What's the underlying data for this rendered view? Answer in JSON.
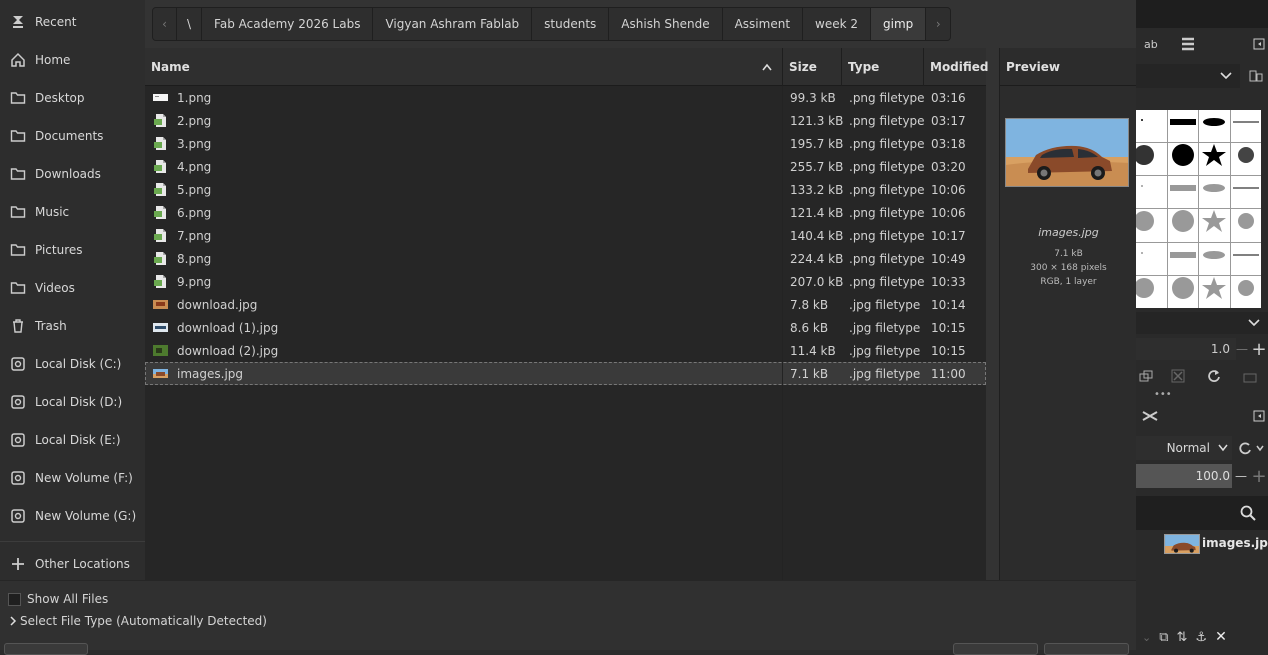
{
  "sidebar": {
    "items": [
      {
        "label": "Recent",
        "icon": "recent-icon"
      },
      {
        "label": "Home",
        "icon": "home-icon"
      },
      {
        "label": "Desktop",
        "icon": "folder-icon"
      },
      {
        "label": "Documents",
        "icon": "folder-icon"
      },
      {
        "label": "Downloads",
        "icon": "folder-icon"
      },
      {
        "label": "Music",
        "icon": "folder-icon"
      },
      {
        "label": "Pictures",
        "icon": "folder-icon"
      },
      {
        "label": "Videos",
        "icon": "folder-icon"
      },
      {
        "label": "Trash",
        "icon": "trash-icon"
      },
      {
        "label": "Local Disk (C:)",
        "icon": "drive-icon"
      },
      {
        "label": "Local Disk (D:)",
        "icon": "drive-icon"
      },
      {
        "label": "Local Disk (E:)",
        "icon": "drive-icon"
      },
      {
        "label": "New Volume (F:)",
        "icon": "drive-icon"
      },
      {
        "label": "New Volume (G:)",
        "icon": "drive-icon"
      }
    ],
    "other_locations": "Other Locations"
  },
  "pathbar": {
    "root": "\\",
    "crumbs": [
      "Fab Academy 2026 Labs",
      "Vigyan Ashram Fablab",
      "students",
      "Ashish Shende",
      "Assiment",
      "week 2",
      "gimp"
    ],
    "back_arrow": "‹",
    "forward_arrow": "›"
  },
  "columns": {
    "name": "Name",
    "size": "Size",
    "type": "Type",
    "modified": "Modified"
  },
  "files": [
    {
      "name": "1.png",
      "size": "99.3 kB",
      "type": ".png filetype",
      "modified": "03:16",
      "kind": "png-thumb-white"
    },
    {
      "name": "2.png",
      "size": "121.3 kB",
      "type": ".png filetype",
      "modified": "03:17",
      "kind": "png"
    },
    {
      "name": "3.png",
      "size": "195.7 kB",
      "type": ".png filetype",
      "modified": "03:18",
      "kind": "png"
    },
    {
      "name": "4.png",
      "size": "255.7 kB",
      "type": ".png filetype",
      "modified": "03:20",
      "kind": "png"
    },
    {
      "name": "5.png",
      "size": "133.2 kB",
      "type": ".png filetype",
      "modified": "10:06",
      "kind": "png"
    },
    {
      "name": "6.png",
      "size": "121.4 kB",
      "type": ".png filetype",
      "modified": "10:06",
      "kind": "png"
    },
    {
      "name": "7.png",
      "size": "140.4 kB",
      "type": ".png filetype",
      "modified": "10:17",
      "kind": "png"
    },
    {
      "name": "8.png",
      "size": "224.4 kB",
      "type": ".png filetype",
      "modified": "10:49",
      "kind": "png"
    },
    {
      "name": "9.png",
      "size": "207.0 kB",
      "type": ".png filetype",
      "modified": "10:33",
      "kind": "png"
    },
    {
      "name": "download.jpg",
      "size": "7.8 kB",
      "type": ".jpg filetype",
      "modified": "10:14",
      "kind": "jpg-orange"
    },
    {
      "name": "download (1).jpg",
      "size": "8.6 kB",
      "type": ".jpg filetype",
      "modified": "10:15",
      "kind": "jpg-blue"
    },
    {
      "name": "download (2).jpg",
      "size": "11.4 kB",
      "type": ".jpg filetype",
      "modified": "10:15",
      "kind": "jpg-green"
    },
    {
      "name": "images.jpg",
      "size": "7.1 kB",
      "type": ".jpg filetype",
      "modified": "11:00",
      "kind": "jpg-car",
      "selected": true
    }
  ],
  "preview": {
    "header": "Preview",
    "name": "images.jpg",
    "size": "7.1 kB",
    "dims": "300 × 168 pixels",
    "info": "RGB, 1 layer"
  },
  "bottom": {
    "show_all": "Show All Files",
    "file_type": "Select File Type (Automatically Detected)"
  },
  "gimp": {
    "brush_size": "1.0",
    "mode": "Normal",
    "opacity": "100.0",
    "layer_name": "images.jpg"
  },
  "colors": {
    "selected_row": "#3a3a3a",
    "accent": "#e0e0e0",
    "sky": "#6fa8d8",
    "sand": "#d49a5c",
    "car": "#8a4a2a"
  }
}
